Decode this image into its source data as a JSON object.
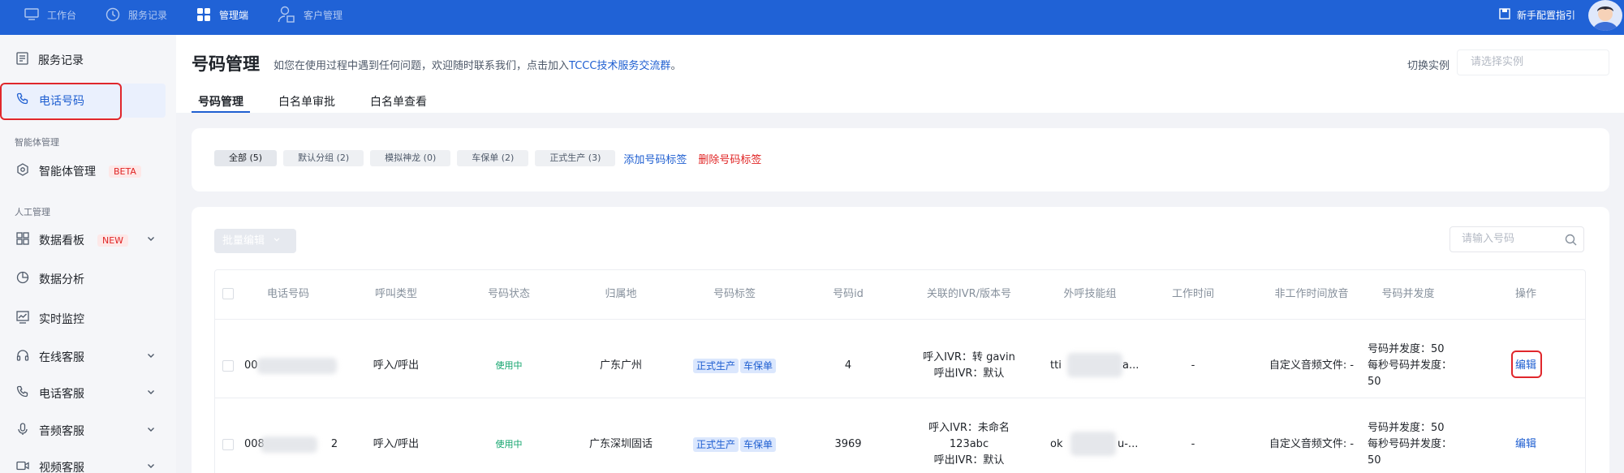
{
  "topnav": {
    "items": [
      {
        "label": "工作台",
        "icon": "monitor-icon"
      },
      {
        "label": "服务记录",
        "icon": "clock-icon"
      },
      {
        "label": "管理端",
        "icon": "grid-icon"
      },
      {
        "label": "客户管理",
        "icon": "user-manage-icon"
      }
    ],
    "active": "管理端",
    "guide_label": "新手配置指引",
    "colors": {
      "bar": "#2062d6"
    }
  },
  "sidebar": {
    "items": {
      "service_records": "服务记录",
      "phone_numbers": "电话号码",
      "section_agent": "智能体管理",
      "agent_manage": "智能体管理",
      "agent_badge": "BETA",
      "section_human": "人工管理",
      "dashboard": "数据看板",
      "dashboard_badge": "NEW",
      "analytics": "数据分析",
      "monitor": "实时监控",
      "online_service": "在线客服",
      "phone_service": "电话客服",
      "audio_service": "音频客服",
      "video_service": "视频客服"
    },
    "selected": "电话号码"
  },
  "page": {
    "title": "号码管理",
    "notice_prefix": "如您在使用过程中遇到任何问题，欢迎随时联系我们，点击加入",
    "notice_link": "TCCC技术服务交流群",
    "notice_suffix": "。",
    "instance_label": "切换实例",
    "instance_placeholder": "请选择实例",
    "tabs": [
      "号码管理",
      "白名单审批",
      "白名单查看"
    ],
    "active_tab": "号码管理"
  },
  "filters": {
    "tags": [
      "全部 (5)",
      "默认分组 (2)",
      "模拟神龙 (0)",
      "车保单 (2)",
      "正式生产 (3)"
    ],
    "selected": "全部 (5)",
    "add_tag": "添加号码标签",
    "delete_tag": "删除号码标签"
  },
  "table": {
    "bulk_edit": "批量编辑",
    "search_placeholder": "请输入号码",
    "columns": [
      "电话号码",
      "呼叫类型",
      "号码状态",
      "归属地",
      "号码标签",
      "号码id",
      "关联的IVR/版本号",
      "外呼技能组",
      "工作时间",
      "非工作时间放音",
      "号码并发度",
      "操作"
    ],
    "rows": [
      {
        "phone": "00",
        "call_type": "呼入/呼出",
        "status": "使用中",
        "location": "广东广州",
        "tags": [
          "正式生产",
          "车保单"
        ],
        "id": "4",
        "ivr_line1": "呼入IVR：转 gavin",
        "ivr_line2": "呼出IVR：默认",
        "skill_prefix": "tti",
        "skill_suffix": "a...",
        "work_time": "-",
        "off_audio": "自定义音频文件: -",
        "concurrency_line1": "号码并发度：50",
        "concurrency_line2": "每秒号码并发度：",
        "concurrency_line3": "50",
        "action": "编辑"
      },
      {
        "phone": "008",
        "phone_suffix": "2",
        "call_type": "呼入/呼出",
        "status": "使用中",
        "location": "广东深圳固话",
        "tags": [
          "正式生产",
          "车保单"
        ],
        "id": "3969",
        "ivr_line1": "呼入IVR：未命名",
        "ivr_line2": "123abc",
        "ivr_line3": "呼出IVR：默认",
        "skill_prefix": "ok",
        "skill_suffix": "u-...",
        "work_time": "-",
        "off_audio": "自定义音频文件: -",
        "concurrency_line1": "号码并发度：50",
        "concurrency_line2": "每秒号码并发度：",
        "concurrency_line3": "50",
        "action": "编辑"
      }
    ]
  }
}
